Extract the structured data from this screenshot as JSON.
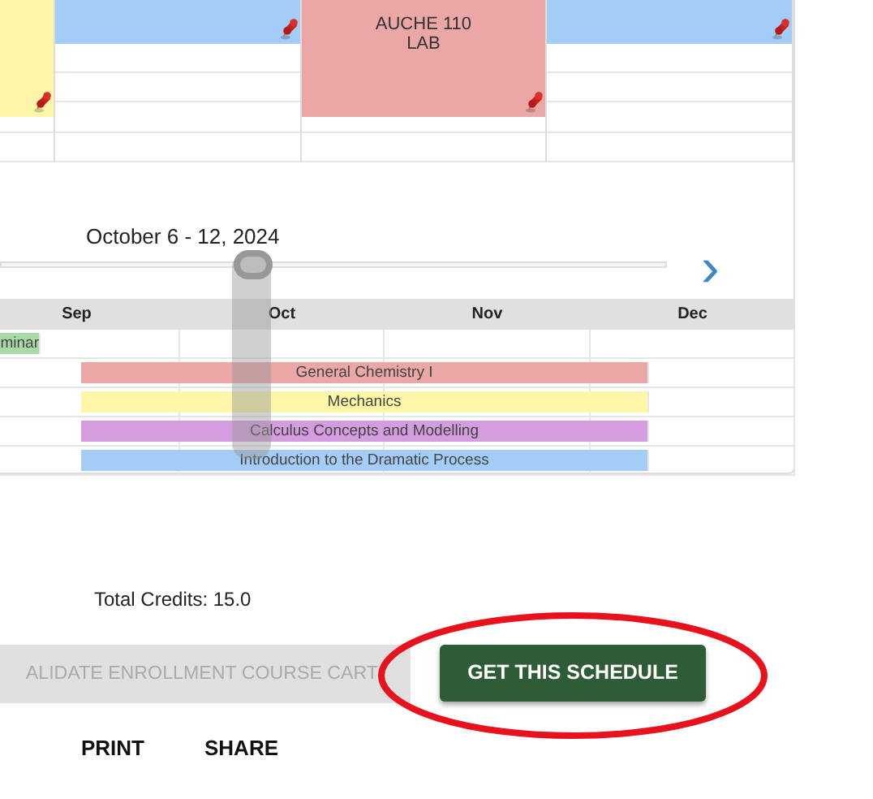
{
  "calendar": {
    "columns": [
      {
        "event": {
          "color": "#fdf6a8",
          "kind": "long"
        }
      },
      {
        "event": {
          "color": "#a3cdf5",
          "kind": "short"
        }
      },
      {
        "event": {
          "color": "#eba6a6",
          "kind": "long",
          "lines": [
            "AUCHE 110",
            "LAB"
          ]
        }
      },
      {
        "event": {
          "color": "#a3cdf5",
          "kind": "short"
        }
      }
    ]
  },
  "week_slider": {
    "label": "October 6 - 12, 2024",
    "level": 0.377,
    "next": "›"
  },
  "timeline": {
    "months": [
      "Sep",
      "Oct",
      "Nov",
      "Dec"
    ],
    "courses": [
      {
        "name": "minar",
        "color": "#a9d8a9",
        "kind": "partial"
      },
      {
        "name": "General Chemistry I",
        "color": "#eba6a6",
        "kind": "term"
      },
      {
        "name": "Mechanics",
        "color": "#fdf6a8",
        "kind": "term"
      },
      {
        "name": "Calculus Concepts and Modelling",
        "color": "#d39ddf",
        "kind": "term"
      },
      {
        "name": "Introduction to the Dramatic Process",
        "color": "#a3cdf5",
        "kind": "term"
      }
    ]
  },
  "total_credits": "Total Credits: 15.0",
  "buttons": [
    {
      "label": "ALIDATE ENROLLMENT COURSE CART",
      "disabled": true
    },
    {
      "label": "GET THIS SCHEDULE",
      "disabled": false,
      "highlighted": true
    }
  ],
  "links": [
    "PRINT",
    "SHARE"
  ]
}
